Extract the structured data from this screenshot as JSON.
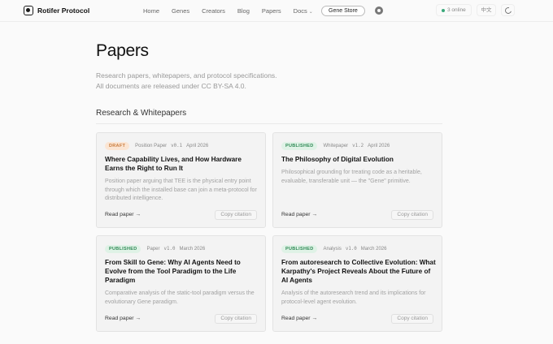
{
  "nav": {
    "brand": "Rotifer Protocol",
    "links": [
      "Home",
      "Genes",
      "Creators",
      "Blog",
      "Papers",
      "Docs"
    ],
    "store_label": "Gene Store",
    "online_label": "3 online",
    "lang_label": "中文"
  },
  "page": {
    "title": "Papers",
    "subtitle_line1": "Research papers, whitepapers, and protocol specifications.",
    "subtitle_line2": "All documents are released under CC BY-SA 4.0.",
    "section_title": "Research & Whitepapers"
  },
  "cards": [
    {
      "status": "DRAFT",
      "kind": "Position Paper",
      "version": "v0.1",
      "date": "April 2026",
      "title": "Where Capability Lives, and How Hardware Earns the Right to Run It",
      "desc": "Position paper arguing that TEE is the physical entry point through which the installed base can join a meta-protocol for distributed intelligence.",
      "read_label": "Read paper →",
      "copy_label": "Copy citation"
    },
    {
      "status": "PUBLISHED",
      "kind": "Whitepaper",
      "version": "v1.2",
      "date": "April 2026",
      "title": "The Philosophy of Digital Evolution",
      "desc": "Philosophical grounding for treating code as a heritable, evaluable, transferable unit — the \"Gene\" primitive.",
      "read_label": "Read paper →",
      "copy_label": "Copy citation"
    },
    {
      "status": "PUBLISHED",
      "kind": "Paper",
      "version": "v1.0",
      "date": "March 2026",
      "title": "From Skill to Gene: Why AI Agents Need to Evolve from the Tool Paradigm to the Life Paradigm",
      "desc": "Comparative analysis of the static-tool paradigm versus the evolutionary Gene paradigm.",
      "read_label": "Read paper →",
      "copy_label": "Copy citation"
    },
    {
      "status": "PUBLISHED",
      "kind": "Analysis",
      "version": "v1.0",
      "date": "March 2026",
      "title": "From autoresearch to Collective Evolution: What Karpathy's Project Reveals About the Future of AI Agents",
      "desc": "Analysis of the autoresearch trend and its implications for protocol-level agent evolution.",
      "read_label": "Read paper →",
      "copy_label": "Copy citation"
    }
  ]
}
